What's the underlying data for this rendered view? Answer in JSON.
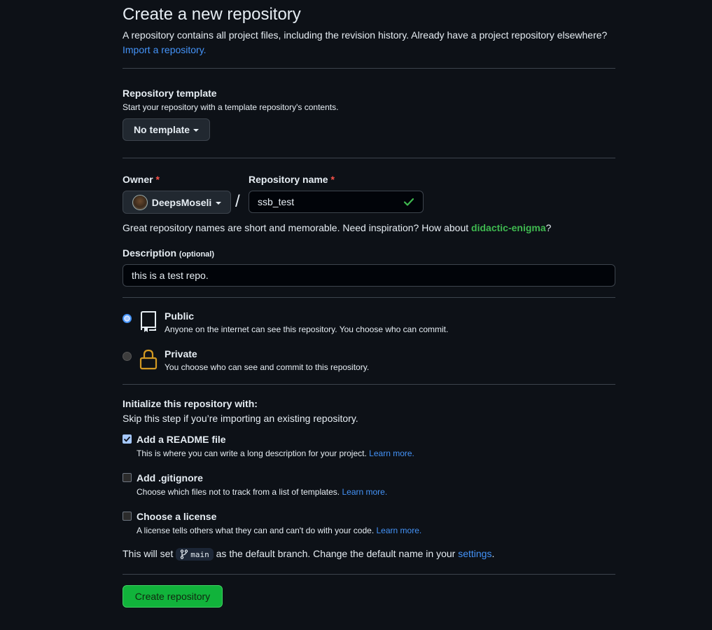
{
  "header": {
    "title": "Create a new repository",
    "subtitle": "A repository contains all project files, including the revision history. Already have a project repository elsewhere?",
    "import_link": "Import a repository."
  },
  "template": {
    "label": "Repository template",
    "note": "Start your repository with a template repository's contents.",
    "selected": "No template"
  },
  "owner": {
    "label": "Owner",
    "required_mark": "*",
    "selected": "DeepsMoseli"
  },
  "separator": "/",
  "repo_name": {
    "label": "Repository name",
    "required_mark": "*",
    "value": "ssb_test",
    "valid": true
  },
  "name_hint": {
    "text": "Great repository names are short and memorable. Need inspiration? How about ",
    "suggestion": "didactic-enigma",
    "suffix": "?"
  },
  "description": {
    "label": "Description",
    "optional": "(optional)",
    "value": "this is a test repo."
  },
  "visibility": [
    {
      "title": "Public",
      "desc": "Anyone on the internet can see this repository. You choose who can commit.",
      "selected": true,
      "icon": "repo-icon"
    },
    {
      "title": "Private",
      "desc": "You choose who can see and commit to this repository.",
      "selected": false,
      "icon": "lock-icon"
    }
  ],
  "init": {
    "title": "Initialize this repository with:",
    "note": "Skip this step if you’re importing an existing repository.",
    "options": [
      {
        "title": "Add a README file",
        "desc": "This is where you can write a long description for your project.",
        "link": "Learn more.",
        "checked": true
      },
      {
        "title": "Add .gitignore",
        "desc": "Choose which files not to track from a list of templates.",
        "link": "Learn more.",
        "checked": false
      },
      {
        "title": "Choose a license",
        "desc": "A license tells others what they can and can't do with your code.",
        "link": "Learn more.",
        "checked": false
      }
    ]
  },
  "branch": {
    "prefix": "This will set",
    "name": "main",
    "middle": "as the default branch. Change the default name in your",
    "settings_link": "settings",
    "suffix": "."
  },
  "submit": {
    "label": "Create repository"
  },
  "colors": {
    "background": "#0d1117",
    "link": "#4493f8",
    "success": "#3fb950",
    "primary_button": "#11b33b",
    "required": "#f85149",
    "lock": "#d29922"
  }
}
